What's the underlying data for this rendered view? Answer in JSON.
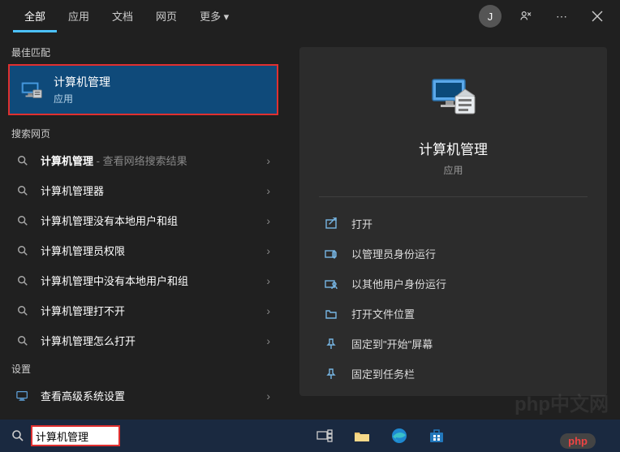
{
  "header": {
    "tabs": [
      {
        "label": "全部",
        "active": true
      },
      {
        "label": "应用",
        "active": false
      },
      {
        "label": "文档",
        "active": false
      },
      {
        "label": "网页",
        "active": false
      },
      {
        "label": "更多 ▾",
        "active": false
      }
    ],
    "avatar_initial": "J",
    "more_label": "⋯"
  },
  "left": {
    "best_match_section": "最佳匹配",
    "best_match": {
      "title": "计算机管理",
      "subtitle": "应用"
    },
    "web_section": "搜索网页",
    "web_items": [
      {
        "bold": "计算机管理",
        "rest": " - 查看网络搜索结果"
      },
      {
        "label": "计算机管理器"
      },
      {
        "label": "计算机管理没有本地用户和组"
      },
      {
        "label": "计算机管理员权限"
      },
      {
        "label": "计算机管理中没有本地用户和组"
      },
      {
        "label": "计算机管理打不开"
      },
      {
        "label": "计算机管理怎么打开"
      }
    ],
    "settings_section": "设置",
    "settings_items": [
      {
        "label": "查看高级系统设置"
      }
    ]
  },
  "right": {
    "title": "计算机管理",
    "subtitle": "应用",
    "actions": [
      {
        "icon": "open",
        "label": "打开"
      },
      {
        "icon": "admin",
        "label": "以管理员身份运行"
      },
      {
        "icon": "user",
        "label": "以其他用户身份运行"
      },
      {
        "icon": "folder",
        "label": "打开文件位置"
      },
      {
        "icon": "pin-start",
        "label": "固定到\"开始\"屏幕"
      },
      {
        "icon": "pin-task",
        "label": "固定到任务栏"
      }
    ]
  },
  "taskbar": {
    "search_value": "计算机管理"
  },
  "watermark": "php中文网"
}
